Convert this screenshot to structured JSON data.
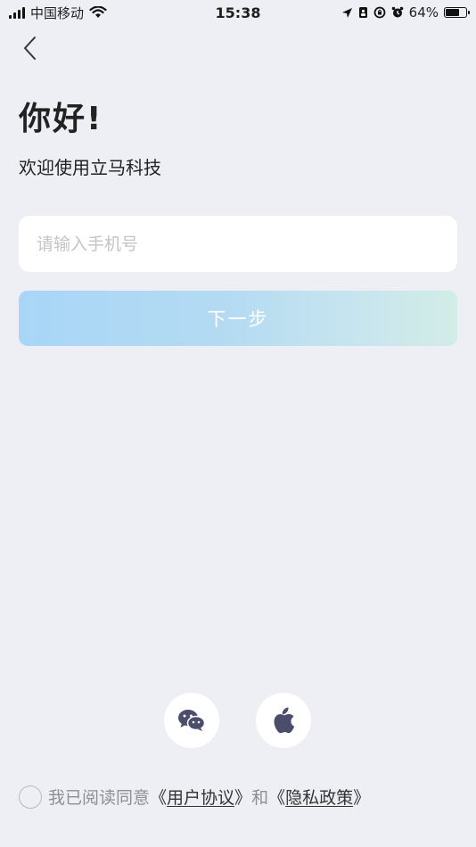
{
  "status_bar": {
    "carrier": "中国移动",
    "time": "15:38",
    "battery": "64%"
  },
  "header": {
    "greeting": "你好!",
    "welcome": "欢迎使用立马科技"
  },
  "form": {
    "phone_placeholder": "请输入手机号",
    "next_label": "下一步"
  },
  "social_login": {
    "icons": [
      "wechat-icon",
      "apple-icon"
    ]
  },
  "agreement": {
    "prefix": "我已阅读同意",
    "open_bracket": "《",
    "close_bracket": "》",
    "user_agreement": "用户协议",
    "and": "和",
    "privacy_policy": "隐私政策"
  },
  "colors": {
    "background": "#EEEFF4",
    "button_gradient_start": "#A9D6F7",
    "button_gradient_end": "#D2ECE6",
    "social_icon": "#4B4E6A"
  }
}
